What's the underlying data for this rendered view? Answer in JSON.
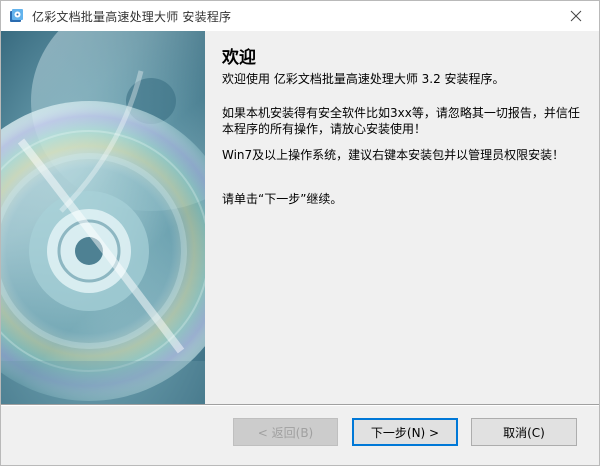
{
  "window": {
    "title": "亿彩文档批量高速处理大师 安装程序"
  },
  "content": {
    "heading": "欢迎",
    "paragraph1": "欢迎使用 亿彩文档批量高速处理大师 3.2 安装程序。",
    "paragraph2": "如果本机安装得有安全软件比如3xx等，请忽略其一切报告，并信任本程序的所有操作，请放心安装使用！",
    "paragraph3": "Win7及以上操作系统，建议右键本安装包并以管理员权限安装！",
    "paragraph4": "请单击“下一步”继续。"
  },
  "buttons": {
    "back": {
      "label": "< 返回(B)",
      "enabled": false
    },
    "next": {
      "label": "下一步(N) >",
      "enabled": true
    },
    "cancel": {
      "label": "取消(C)",
      "enabled": true
    }
  },
  "icons": {
    "app": "installer-app-icon",
    "close": "close-icon",
    "banner": "cd-disc-banner-image"
  },
  "colors": {
    "window_bg": "#f0f0f0",
    "banner_bg": "#3a6f84",
    "focus_border": "#0078d7"
  }
}
